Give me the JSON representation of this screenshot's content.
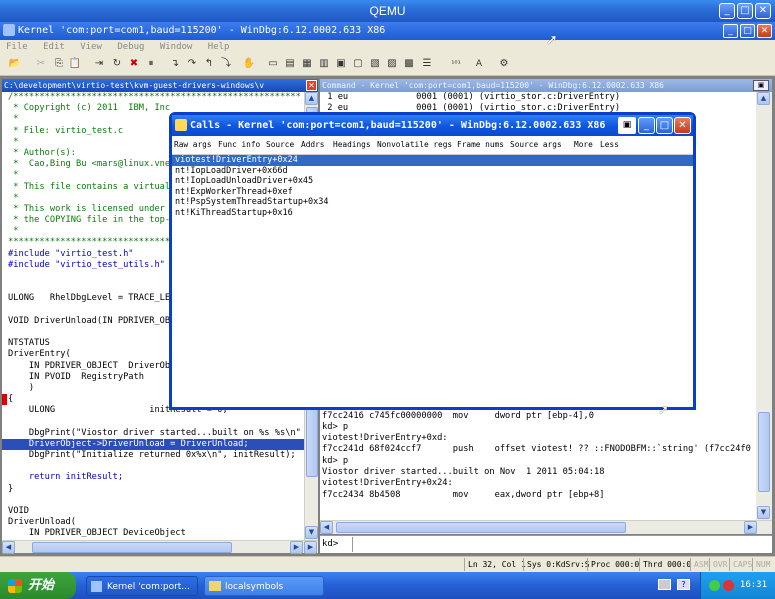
{
  "qemu": {
    "title": "QEMU"
  },
  "windbg": {
    "title": "Kernel 'com:port=com1,baud=115200' - WinDbg:6.12.0002.633 X86",
    "menu": [
      "File",
      "Edit",
      "View",
      "Debug",
      "Window",
      "Help"
    ]
  },
  "source": {
    "title": "C:\\development\\virtio-test\\kvm-guest-drivers-windows\\v",
    "lines": [
      {
        "t": "/*******************************************************",
        "c": "cmt"
      },
      {
        "t": " * Copyright (c) 2011  IBM, Inc",
        "c": "cmt"
      },
      {
        "t": " *",
        "c": "cmt"
      },
      {
        "t": " * File: virtio_test.c",
        "c": "cmt"
      },
      {
        "t": " *",
        "c": "cmt"
      },
      {
        "t": " * Author(s):",
        "c": "cmt"
      },
      {
        "t": " *  Cao,Bing Bu <mars@linux.vne",
        "c": "cmt"
      },
      {
        "t": " *",
        "c": "cmt"
      },
      {
        "t": " * This file contains a virtual",
        "c": "cmt"
      },
      {
        "t": " *",
        "c": "cmt"
      },
      {
        "t": " * This work is licensed under",
        "c": "cmt"
      },
      {
        "t": " * the COPYING file in the top-",
        "c": "cmt"
      },
      {
        "t": " *",
        "c": "cmt"
      },
      {
        "t": "********************************",
        "c": "cmt"
      },
      {
        "t": "#include \"virtio_test.h\"",
        "c": "pp"
      },
      {
        "t": "#include \"virtio_test_utils.h\"",
        "c": "pp"
      },
      {
        "t": "",
        "c": ""
      },
      {
        "t": "",
        "c": ""
      },
      {
        "t": "ULONG   RhelDbgLevel = TRACE_LE",
        "c": ""
      },
      {
        "t": "",
        "c": ""
      },
      {
        "t": "VOID DriverUnload(IN PDRIVER_OB",
        "c": ""
      },
      {
        "t": "",
        "c": ""
      },
      {
        "t": "NTSTATUS",
        "c": ""
      },
      {
        "t": "DriverEntry(",
        "c": ""
      },
      {
        "t": "    IN PDRIVER_OBJECT  DriverOb",
        "c": ""
      },
      {
        "t": "    IN PVOID  RegistryPath",
        "c": ""
      },
      {
        "t": "    )",
        "c": ""
      },
      {
        "t": "{",
        "c": "brace"
      },
      {
        "t": "    ULONG                  initResult = 0;",
        "c": ""
      },
      {
        "t": "",
        "c": ""
      },
      {
        "t": "    DbgPrint(\"Viostor driver started...built on %s %s\\n\"",
        "c": "dbg"
      },
      {
        "t": "    DriverObject->DriverUnload = DriverUnload;",
        "c": "hl"
      },
      {
        "t": "    DbgPrint(\"Initialize returned 0x%x\\n\", initResult);",
        "c": "dbg2"
      },
      {
        "t": "",
        "c": ""
      },
      {
        "t": "    return initResult;",
        "c": "ret"
      },
      {
        "t": "}",
        "c": ""
      },
      {
        "t": "",
        "c": ""
      },
      {
        "t": "VOID",
        "c": ""
      },
      {
        "t": "DriverUnload(",
        "c": ""
      },
      {
        "t": "    IN PDRIVER_OBJECT DeviceObject",
        "c": ""
      }
    ]
  },
  "command": {
    "title": "Command - Kernel 'com:port=com1,baud=115200' - WinDbg:6.12.0002.633 X86",
    "top_lines": [
      " 1 eu             0001 (0001) (virtio_stor.c:DriverEntry)",
      " 2 eu             0001 (0001) (virtio_stor.c:DriverEntry)"
    ],
    "bottom_lines": [
      "f7cc2416 c745fc00000000  mov     dword ptr [ebp-4],0",
      "kd> p",
      "viotest!DriverEntry+0xd:",
      "f7cc241d 68f024ccf7      push    offset viotest! ?? ::FNODOBFM::`string' (f7cc24f0",
      "kd> p",
      "Viostor driver started...built on Nov  1 2011 05:04:18",
      "viotest!DriverEntry+0x24:",
      "f7cc2434 8b4508          mov     eax,dword ptr [ebp+8]"
    ],
    "prompt": "kd>"
  },
  "calls": {
    "title": "Calls - Kernel 'com:port=com1,baud=115200' - WinDbg:6.12.0002.633 X86",
    "options": [
      "Raw args",
      "Func info",
      "Source",
      "Addrs",
      "Headings",
      "Nonvolatile regs",
      "Frame nums",
      "Source args",
      "More",
      "Less"
    ],
    "frames": [
      "viotest!DriverEntry+0x24",
      "nt!IopLoadDriver+0x66d",
      "nt!IopLoadUnloadDriver+0x45",
      "nt!ExpWorkerThread+0xef",
      "nt!PspSystemThreadStartup+0x34",
      "nt!KiThreadStartup+0x16"
    ]
  },
  "status": {
    "position": "Ln 32, Col 1",
    "sys": "Sys 0:KdSrv:S",
    "proc": "Proc 000:0",
    "thrd": "Thrd 000:0",
    "flags": [
      "ASM",
      "OVR",
      "CAPS",
      "NUM"
    ]
  },
  "taskbar": {
    "start": "开始",
    "tasks": [
      "Kernel 'com:port...",
      "localsymbols"
    ],
    "clock": "16:31"
  }
}
